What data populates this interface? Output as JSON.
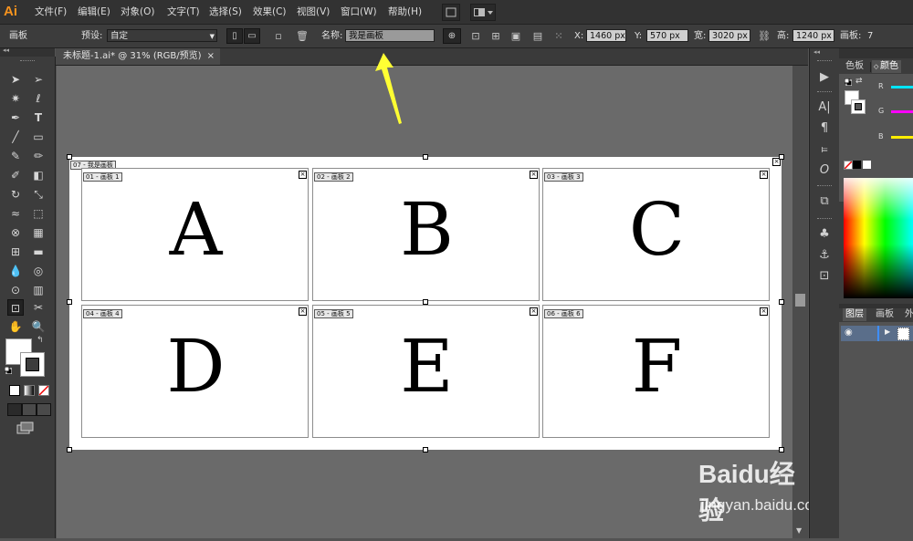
{
  "app": {
    "logo": "Ai"
  },
  "menu": {
    "items": [
      "文件(F)",
      "编辑(E)",
      "对象(O)",
      "文字(T)",
      "选择(S)",
      "效果(C)",
      "视图(V)",
      "窗口(W)",
      "帮助(H)"
    ]
  },
  "control_bar": {
    "context_label": "画板",
    "preset_label": "预设:",
    "preset_value": "自定",
    "name_label": "名称:",
    "name_value": "我是画板",
    "x_label": "X:",
    "x_value": "1460 px",
    "y_label": "Y:",
    "y_value": "570 px",
    "w_label": "宽:",
    "w_value": "3020 px",
    "h_label": "高:",
    "h_value": "1240 px",
    "count_label": "画板:",
    "count_value": "7"
  },
  "document": {
    "tab_title": "未标题-1.ai* @ 31% (RGB/预览)",
    "tab_close": "×"
  },
  "artboards": {
    "outer_label": "07 - 我是画板",
    "boards": [
      {
        "label": "01 - 画板 1",
        "letter": "A"
      },
      {
        "label": "02 - 画板 2",
        "letter": "B"
      },
      {
        "label": "03 - 画板 3",
        "letter": "C"
      },
      {
        "label": "04 - 画板 4",
        "letter": "D"
      },
      {
        "label": "05 - 画板 5",
        "letter": "E"
      },
      {
        "label": "06 - 画板 6",
        "letter": "F"
      }
    ]
  },
  "panels": {
    "color_tabs": [
      "色板",
      "颜色"
    ],
    "channels": [
      "R",
      "G",
      "B"
    ],
    "channel_colors": [
      "#00e5ff",
      "#ff00ff",
      "#ffee00"
    ],
    "layer_tabs": [
      "图层",
      "画板",
      "外"
    ]
  },
  "watermark": {
    "brand": "Baidu经验",
    "url": "jingyan.baidu.com"
  },
  "colors": {
    "arrow": "#ffff33",
    "canvas": "#6a6a6a",
    "accent_logo": "#f7931e"
  }
}
